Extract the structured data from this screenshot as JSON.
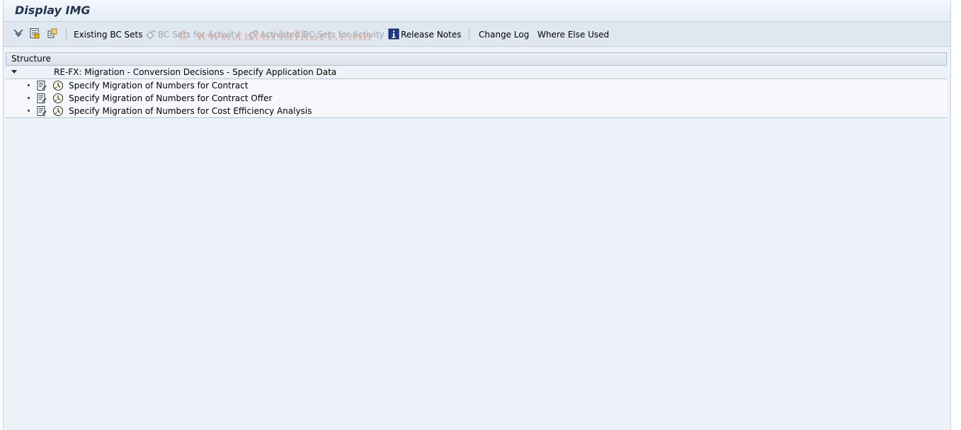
{
  "window": {
    "title": "Display IMG"
  },
  "toolbar": {
    "icon_buttons": [
      "expand-all-icon",
      "display-docu-icon",
      "sap-reference-img-icon"
    ],
    "existing_bc_sets": "Existing BC Sets",
    "bc_sets_for_activity": "BC Sets for Activity",
    "activated_bc_sets": "Activated BC Sets for Activity",
    "release_notes": "Release Notes",
    "change_log": "Change Log",
    "where_else_used": "Where Else Used"
  },
  "watermark": "© www.tutorialkart.com",
  "structure": {
    "header": "Structure",
    "root": "RE-FX: Migration - Conversion Decisions - Specify Application Data",
    "items": [
      {
        "label": "Specify Migration of Numbers for Contract"
      },
      {
        "label": "Specify Migration of Numbers for Contract Offer"
      },
      {
        "label": "Specify Migration of Numbers for Cost Efficiency Analysis"
      }
    ]
  },
  "colors": {
    "background": "#edf2f8",
    "toolbar": "#dfe8f1",
    "title": "#1f3552",
    "disabled_text": "#9aa6b2",
    "watermark": "#dc9678"
  }
}
